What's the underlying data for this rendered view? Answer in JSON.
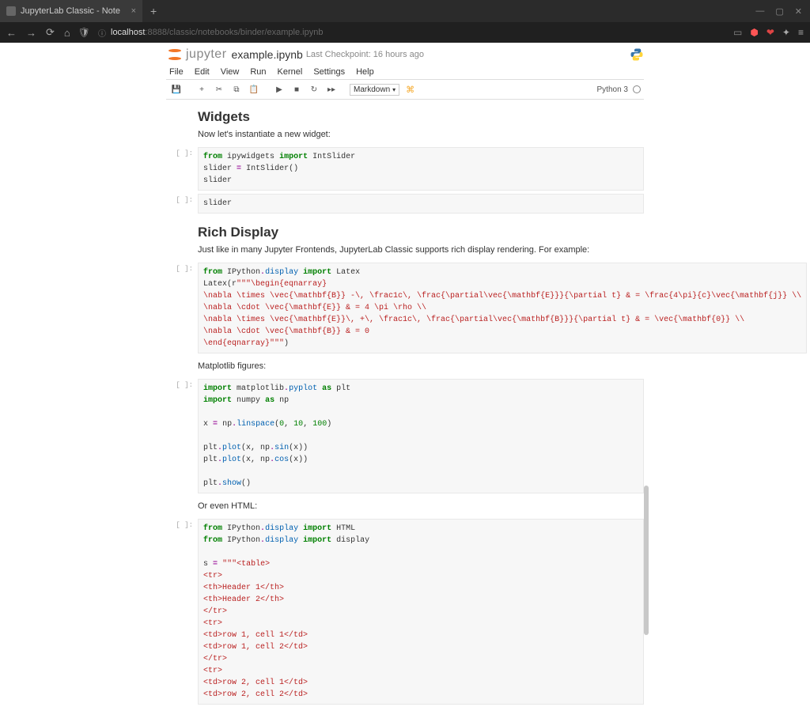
{
  "browser": {
    "tab_title": "JupyterLab Classic - Note",
    "url_host": "localhost",
    "url_path": ":8888/classic/notebooks/binder/example.ipynb"
  },
  "header": {
    "logo_text": "jupyter",
    "notebook_name": "example.ipynb",
    "checkpoint": "Last Checkpoint: 16 hours ago"
  },
  "menu": {
    "file": "File",
    "edit": "Edit",
    "view": "View",
    "run": "Run",
    "kernel": "Kernel",
    "settings": "Settings",
    "help": "Help"
  },
  "toolbar": {
    "cell_type": "Markdown",
    "kernel_name": "Python 3"
  },
  "content": {
    "widgets_heading": "Widgets",
    "widgets_text": "Now let's instantiate a new widget:",
    "rich_heading": "Rich Display",
    "rich_text": "Just like in many Jupyter Frontends, JupyterLab Classic supports rich display rendering. For example:",
    "mpl_text": "Matplotlib figures:",
    "html_text": "Or even HTML:"
  },
  "code": {
    "c1": {
      "l1a": "from",
      "l1b": "ipywidgets",
      "l1c": "import",
      "l1d": "IntSlider",
      "l2a": "slider",
      "l2b": "=",
      "l2c": "IntSlider",
      "l2d": "()",
      "l3": "slider"
    },
    "c2": {
      "l1": "slider"
    },
    "c3": {
      "l1a": "from",
      "l1b": "IPython",
      "l1c": ".",
      "l1d": "display",
      "l1e": "import",
      "l1f": "Latex",
      "l2a": "Latex",
      "l2b": "(",
      "l2c": "r",
      "l2d": "\"\"\"\\begin{eqnarray}",
      "l3": "\\nabla \\times \\vec{\\mathbf{B}} -\\, \\frac1c\\, \\frac{\\partial\\vec{\\mathbf{E}}}{\\partial t} & = \\frac{4\\pi}{c}\\vec{\\mathbf{j}} \\\\",
      "l4": "\\nabla \\cdot \\vec{\\mathbf{E}} & = 4 \\pi \\rho \\\\",
      "l5": "\\nabla \\times \\vec{\\mathbf{E}}\\, +\\, \\frac1c\\, \\frac{\\partial\\vec{\\mathbf{B}}}{\\partial t} & = \\vec{\\mathbf{0}} \\\\",
      "l6": "\\nabla \\cdot \\vec{\\mathbf{B}} & = 0",
      "l7a": "\\end{eqnarray}\"\"\"",
      "l7b": ")"
    },
    "c4": {
      "l1a": "import",
      "l1b": "matplotlib",
      "l1c": ".",
      "l1d": "pyplot",
      "l1e": "as",
      "l1f": "plt",
      "l2a": "import",
      "l2b": "numpy",
      "l2c": "as",
      "l2d": "np",
      "l4a": "x",
      "l4b": "=",
      "l4c": "np",
      "l4d": ".",
      "l4e": "linspace",
      "l4f": "(",
      "l4g": "0",
      "l4h": ",",
      "l4i": "10",
      "l4j": ",",
      "l4k": "100",
      "l4l": ")",
      "l6a": "plt",
      "l6b": ".",
      "l6c": "plot",
      "l6d": "(x, np",
      "l6e": ".",
      "l6f": "sin",
      "l6g": "(x))",
      "l7a": "plt",
      "l7b": ".",
      "l7c": "plot",
      "l7d": "(x, np",
      "l7e": ".",
      "l7f": "cos",
      "l7g": "(x))",
      "l9a": "plt",
      "l9b": ".",
      "l9c": "show",
      "l9d": "()"
    },
    "c5": {
      "l1a": "from",
      "l1b": "IPython",
      "l1c": ".",
      "l1d": "display",
      "l1e": "import",
      "l1f": "HTML",
      "l2a": "from",
      "l2b": "IPython",
      "l2c": ".",
      "l2d": "display",
      "l2e": "import",
      "l2f": "display",
      "l4a": "s",
      "l4b": "=",
      "l4c": "\"\"\"<table>",
      "l5": "<tr>",
      "l6": "<th>Header 1</th>",
      "l7": "<th>Header 2</th>",
      "l8": "</tr>",
      "l9": "<tr>",
      "l10": "<td>row 1, cell 1</td>",
      "l11": "<td>row 1, cell 2</td>",
      "l12": "</tr>",
      "l13": "<tr>",
      "l14": "<td>row 2, cell 1</td>",
      "l15": "<td>row 2, cell 2</td>"
    }
  },
  "prompts": {
    "empty": "[ ]:"
  }
}
